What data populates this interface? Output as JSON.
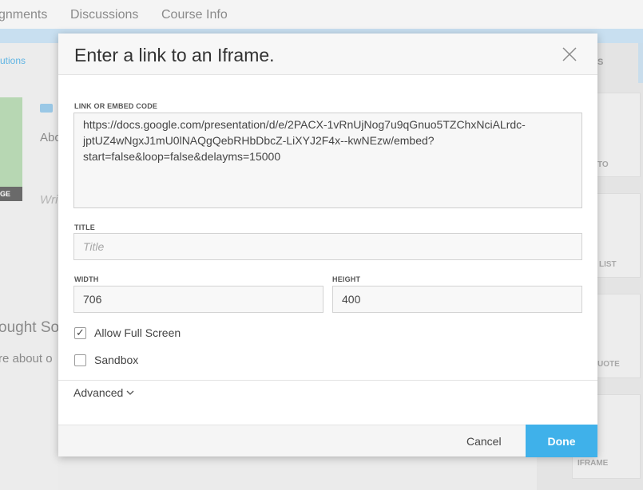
{
  "background": {
    "nav_items": [
      "gnments",
      "Discussions",
      "Course Info"
    ],
    "left_link": "utions",
    "left_image_caption": "GE",
    "left_text_1": "Abo",
    "left_text_2": "Wri",
    "left_big_1": "ought So",
    "left_big_2": "re about o",
    "right_tab": "S",
    "right_labels": [
      "TO",
      "LIST",
      "UOTE",
      "IFRAME"
    ]
  },
  "modal": {
    "title": "Enter a link to an Iframe.",
    "embed_label": "LINK OR EMBED CODE",
    "embed_value": "https://docs.google.com/presentation/d/e/2PACX-1vRnUjNog7u9qGnuo5TZChxNciALrdc-jptUZ4wNgxJ1mU0lNAQgQebRHbDbcZ-LiXYJ2F4x--kwNEzw/embed?start=false&loop=false&delayms=15000",
    "title_label": "TITLE",
    "title_placeholder": "Title",
    "width_label": "WIDTH",
    "width_value": "706",
    "height_label": "HEIGHT",
    "height_value": "400",
    "allow_fullscreen_label": "Allow Full Screen",
    "allow_fullscreen_checked": true,
    "sandbox_label": "Sandbox",
    "sandbox_checked": false,
    "advanced_label": "Advanced",
    "cancel_label": "Cancel",
    "done_label": "Done",
    "check_glyph": "✓"
  },
  "colors": {
    "accent": "#3fb1ea"
  }
}
